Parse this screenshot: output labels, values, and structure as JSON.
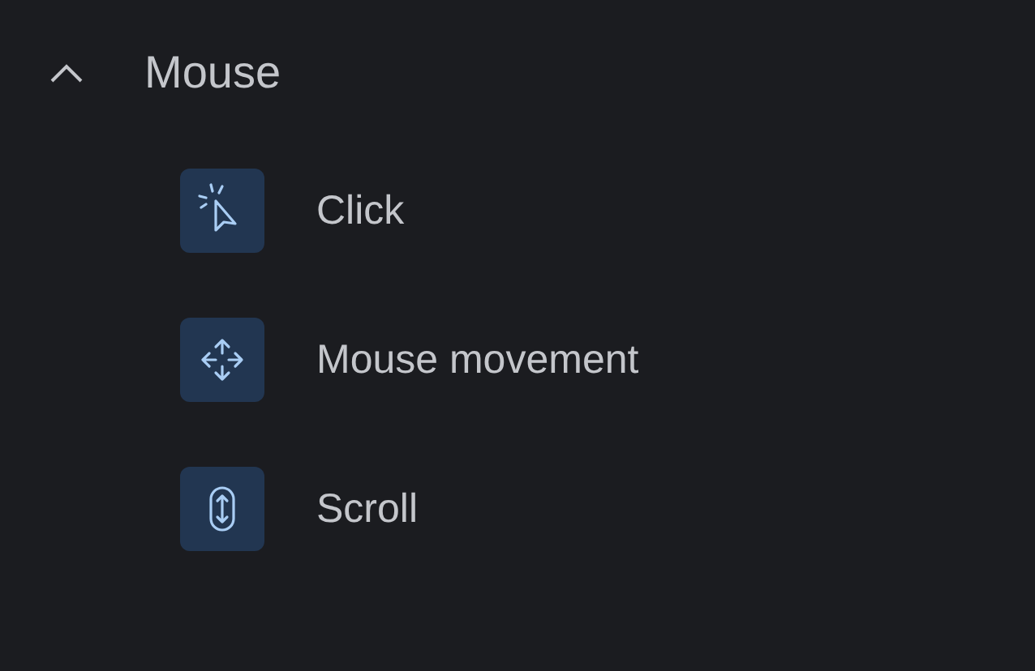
{
  "section": {
    "title": "Mouse",
    "expanded": true,
    "items": [
      {
        "kind": "click",
        "label": "Click"
      },
      {
        "kind": "move",
        "label": "Mouse movement"
      },
      {
        "kind": "scroll",
        "label": "Scroll"
      }
    ]
  }
}
